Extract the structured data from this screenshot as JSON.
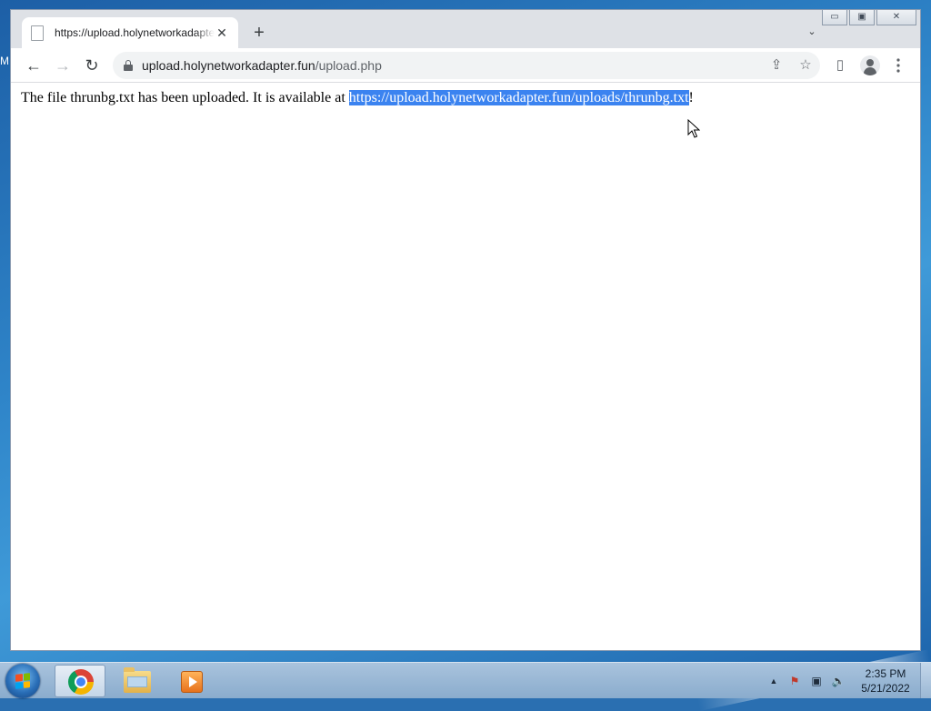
{
  "desktop": {
    "edge_glyph": "M"
  },
  "browser": {
    "tab": {
      "title": "https://upload.holynetworkadapter.fun/upload.php",
      "close_glyph": "✕"
    },
    "new_tab_glyph": "+",
    "tab_search_glyph": "⌄",
    "window_controls": {
      "minimize": "▭",
      "maximize": "▣",
      "close": "✕"
    },
    "nav": {
      "back": "←",
      "forward": "→",
      "reload": "↻"
    },
    "address": {
      "host": "upload.holynetworkadapter.fun",
      "path": "/upload.php"
    },
    "toolbar_icons": {
      "share": "⇪",
      "bookmark": "☆",
      "side_panel": "▯"
    }
  },
  "page": {
    "message_prefix": "The file thrunbg.txt has been uploaded. It is available at ",
    "link_text": "https://upload.holynetworkadapter.fun/uploads/thrunbg.txt",
    "message_suffix": "!"
  },
  "taskbar": {
    "tray_glyphs": {
      "expand": "▲",
      "flag": "⚑",
      "network": "▣",
      "volume": "🔈"
    },
    "clock_time": "2:35 PM",
    "clock_date": "5/21/2022"
  },
  "colors": {
    "selection_highlight": "#3b83f0",
    "tabstrip": "#dee1e6",
    "omnibox": "#f1f3f4",
    "taskbar": "#9ab7d4"
  }
}
